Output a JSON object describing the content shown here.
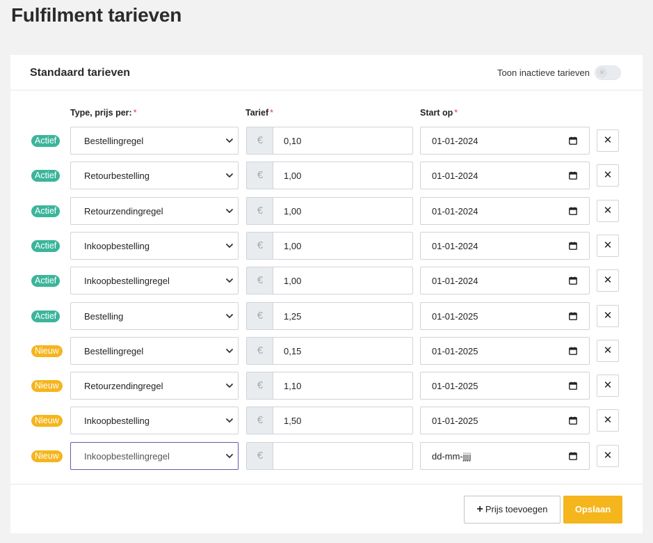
{
  "page": {
    "title": "Fulfilment tarieven"
  },
  "card": {
    "title": "Standaard tarieven",
    "toggle_label": "Toon inactieve tarieven",
    "toggle_state": "off"
  },
  "columns": {
    "type": "Type, prijs per:",
    "tarief": "Tarief",
    "start": "Start op",
    "required_mark": "*"
  },
  "currency_symbol": "€",
  "rows": [
    {
      "status": "Actief",
      "type": "Bestellingregel",
      "tarief": "0,10",
      "start": "01-01-2024"
    },
    {
      "status": "Actief",
      "type": "Retourbestelling",
      "tarief": "1,00",
      "start": "01-01-2024"
    },
    {
      "status": "Actief",
      "type": "Retourzendingregel",
      "tarief": "1,00",
      "start": "01-01-2024"
    },
    {
      "status": "Actief",
      "type": "Inkoopbestelling",
      "tarief": "1,00",
      "start": "01-01-2024"
    },
    {
      "status": "Actief",
      "type": "Inkoopbestellingregel",
      "tarief": "1,00",
      "start": "01-01-2024"
    },
    {
      "status": "Actief",
      "type": "Bestelling",
      "tarief": "1,25",
      "start": "01-01-2025"
    },
    {
      "status": "Nieuw",
      "type": "Bestellingregel",
      "tarief": "0,15",
      "start": "01-01-2025"
    },
    {
      "status": "Nieuw",
      "type": "Retourzendingregel",
      "tarief": "1,10",
      "start": "01-01-2025"
    },
    {
      "status": "Nieuw",
      "type": "Inkoopbestelling",
      "tarief": "1,50",
      "start": "01-01-2025"
    },
    {
      "status": "Nieuw",
      "type": "Inkoopbestellingregel",
      "tarief": "",
      "start": "dd-mm-jjjj"
    }
  ],
  "buttons": {
    "add": "Prijs toevoegen",
    "save": "Opslaan",
    "delete_glyph": "✕"
  },
  "colors": {
    "actief": "#3bb59a",
    "nieuw": "#f5b51c",
    "save": "#f5b51c"
  },
  "icons": {
    "chevron": "chevron-down-icon",
    "calendar": "calendar-icon",
    "delete": "close-icon",
    "plus": "plus-icon"
  }
}
